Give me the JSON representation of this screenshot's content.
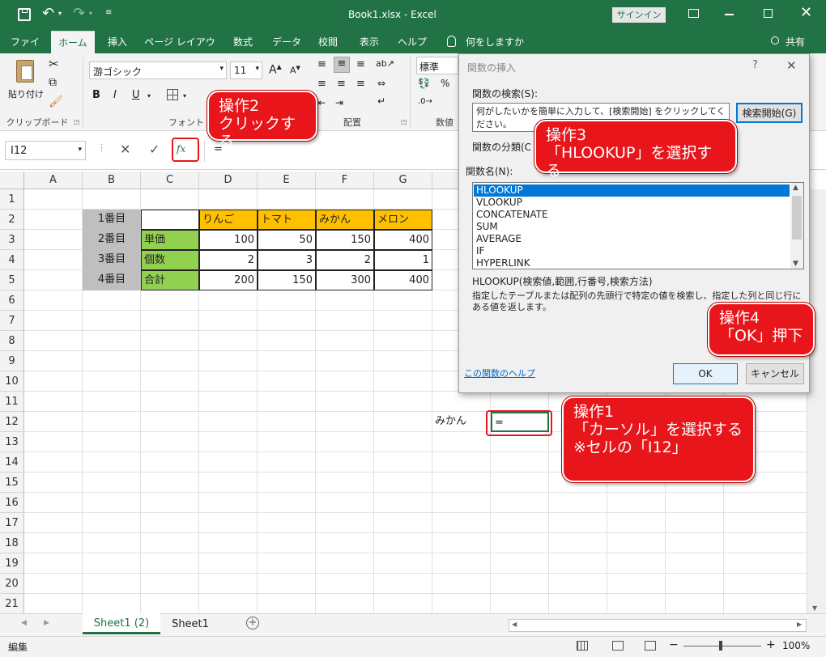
{
  "window": {
    "title": "Book1.xlsx - Excel",
    "signin": "サインイン"
  },
  "tabs": [
    "ファイル",
    "ホーム",
    "挿入",
    "ページ レイアウト",
    "数式",
    "データ",
    "校閲",
    "表示",
    "ヘルプ",
    "何をしますか"
  ],
  "share": "共有",
  "ribbon": {
    "paste": "貼り付け",
    "clipboard": "クリップボード",
    "font_name": "游ゴシック",
    "font_size": "11",
    "font_group": "フォント",
    "align_group": "配置",
    "number_format": "標準",
    "number_group": "数値"
  },
  "formula_bar": {
    "name_box": "I12",
    "fx": "fx",
    "formula": "="
  },
  "columns": [
    "A",
    "B",
    "C",
    "D",
    "E",
    "F",
    "G"
  ],
  "rows": [
    "1",
    "2",
    "3",
    "4",
    "5",
    "6",
    "7",
    "8",
    "9",
    "10",
    "11",
    "12",
    "13",
    "14",
    "15",
    "16",
    "17",
    "18",
    "19",
    "20",
    "21"
  ],
  "table": {
    "b": [
      "1番目",
      "2番目",
      "3番目",
      "4番目"
    ],
    "c": [
      "",
      "単価",
      "個数",
      "合計"
    ],
    "header": [
      "りんご",
      "トマト",
      "みかん",
      "メロン"
    ],
    "price": [
      "100",
      "50",
      "150",
      "400"
    ],
    "qty": [
      "2",
      "3",
      "2",
      "1"
    ],
    "total": [
      "200",
      "150",
      "300",
      "400"
    ]
  },
  "cells": {
    "h12": "みかん",
    "i12": "="
  },
  "dialog": {
    "title": "関数の挿入",
    "help": "?",
    "search_label": "関数の検索(S):",
    "search_value": "何がしたいかを簡単に入力して、[検索開始] をクリックしてください。",
    "search_button": "検索開始(G)",
    "category_label": "関数の分類(C",
    "name_label": "関数名(N):",
    "functions": [
      "HLOOKUP",
      "VLOOKUP",
      "CONCATENATE",
      "SUM",
      "AVERAGE",
      "IF",
      "HYPERLINK"
    ],
    "signature": "HLOOKUP(検索値,範囲,行番号,検索方法)",
    "description": "指定したテーブルまたは配列の先頭行で特定の値を検索し、指定した列と同じ行にある値を返します。",
    "help_link": "この関数のヘルプ",
    "ok": "OK",
    "cancel": "キャンセル"
  },
  "callouts": {
    "op1_title": "操作1",
    "op1_line1": "「カーソル」を選択する",
    "op1_line2": "※セルの「I12」",
    "op2_title": "操作2",
    "op2_line1": "クリックする",
    "op3_title": "操作3",
    "op3_line1": "「HLOOKUP」を選択する",
    "op4_title": "操作4",
    "op4_line1": "「OK」押下"
  },
  "sheets": [
    "Sheet1 (2)",
    "Sheet1"
  ],
  "status": {
    "mode": "編集",
    "zoom": "100%"
  },
  "colors": {
    "excel_green": "#217346",
    "callout_red": "#e8161a",
    "header_orange": "#ffc000",
    "label_green": "#92d050",
    "label_gray": "#bfbfbf"
  }
}
